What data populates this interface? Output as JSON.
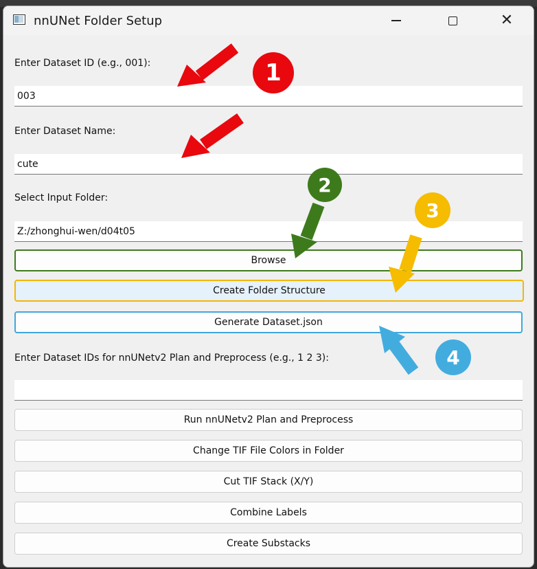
{
  "window": {
    "title": "nnUNet Folder Setup",
    "minimize_label": "—",
    "maximize_label": "□",
    "close_label": "✕"
  },
  "form": {
    "dataset_id_label": "Enter Dataset ID (e.g., 001):",
    "dataset_id_value": "003",
    "dataset_name_label": "Enter Dataset Name:",
    "dataset_name_value": "cute",
    "input_folder_label": "Select Input Folder:",
    "input_folder_value": "Z:/zhonghui-wen/d04t05",
    "browse_button": "Browse",
    "create_structure_button": "Create Folder Structure",
    "generate_json_button": "Generate Dataset.json",
    "plan_ids_label": "Enter Dataset IDs for nnUNetv2 Plan and Preprocess (e.g., 1 2 3):",
    "plan_ids_value": "",
    "run_plan_button": "Run nnUNetv2 Plan and Preprocess",
    "change_colors_button": "Change TIF File Colors in Folder",
    "cut_stack_button": "Cut TIF Stack (X/Y)",
    "combine_labels_button": "Combine Labels",
    "create_substacks_button": "Create Substacks"
  },
  "annotations": {
    "badge_1": "1",
    "badge_2": "2",
    "badge_3": "3",
    "badge_4": "4",
    "colors": {
      "red": "#e8080e",
      "green": "#3d7a1c",
      "orange": "#f5bc00",
      "blue": "#43acdf"
    }
  }
}
